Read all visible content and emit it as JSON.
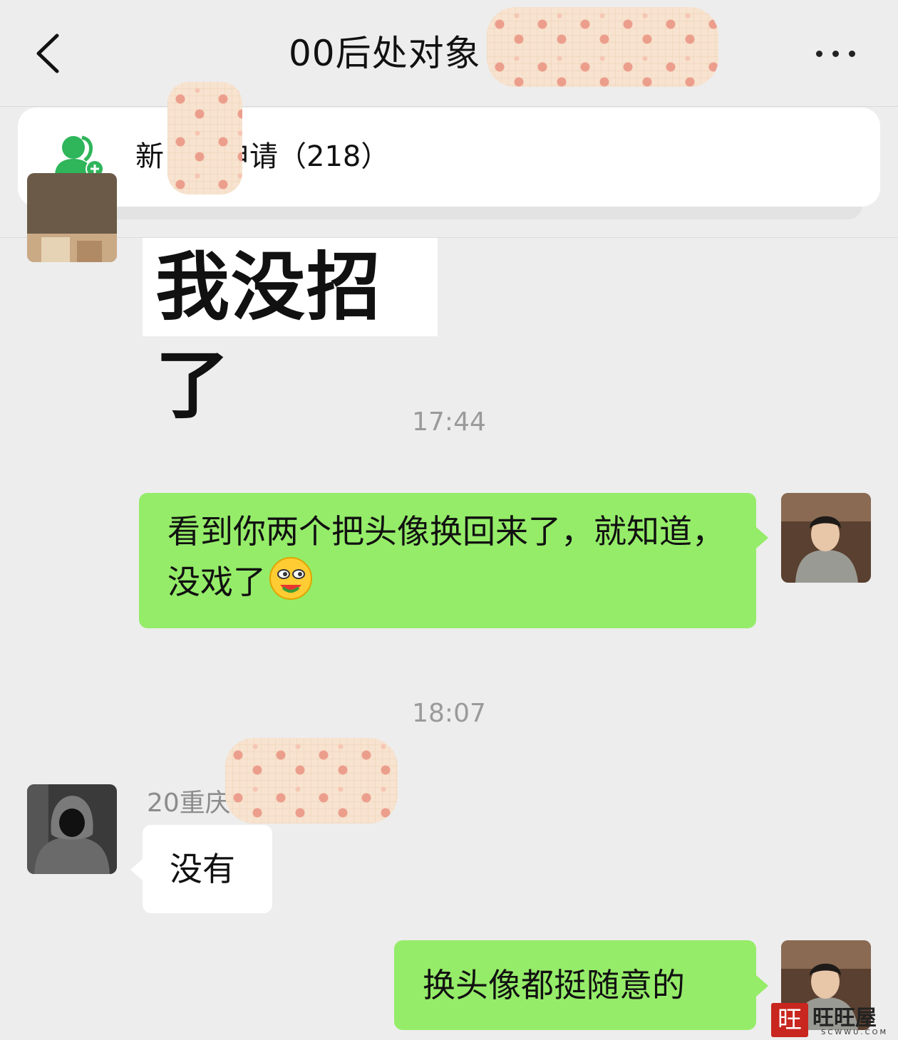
{
  "header": {
    "title": "00后处对象",
    "back_icon": "chevron-left-icon",
    "more_icon": "more-dots-icon"
  },
  "notice": {
    "icon": "add-friend-icon",
    "label": "新　　申请（218）"
  },
  "messages": [
    {
      "from": "other",
      "type": "sticker",
      "text": "我没招了"
    },
    {
      "type": "timestamp",
      "text": "17:44"
    },
    {
      "from": "me",
      "type": "text",
      "text": "看到你两个把头像换回来了，就知道，没戏了",
      "emoji": "drooling-face-emoji"
    },
    {
      "type": "timestamp",
      "text": "18:07"
    },
    {
      "from": "other",
      "sender": "20重庆",
      "type": "text",
      "text": "没有"
    },
    {
      "from": "me",
      "type": "text",
      "text": "换头像都挺随意的"
    }
  ],
  "watermark": {
    "seal": "旺",
    "text": "旺旺屋",
    "sub": "SCWWU.COM"
  },
  "colors": {
    "background": "#ededed",
    "my_bubble": "#95ec69",
    "other_bubble": "#ffffff",
    "wechat_green": "#2fb55a",
    "timestamp": "#9a9a9a"
  }
}
